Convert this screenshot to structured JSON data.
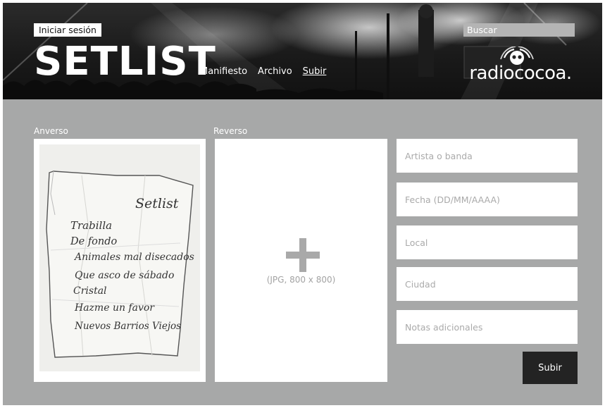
{
  "header": {
    "login_label": "Iniciar sesión",
    "logo_text": "SETLIST",
    "nav": [
      "Manifiesto",
      "Archivo",
      "Subir"
    ],
    "active_nav": "Subir",
    "search_placeholder": "Buscar",
    "partner_logo": "radiococoa."
  },
  "upload": {
    "front_label": "Anverso",
    "back_label": "Reverso",
    "back_hint": "(JPG, 800 x 800)",
    "setlist_note": {
      "title": "Setlist",
      "songs": [
        "Trabilla",
        "De fondo",
        "Animales mal disecados",
        "Que asco de sábado",
        "Cristal",
        "Hazme un favor",
        "Nuevos Barrios Viejos"
      ]
    }
  },
  "form": {
    "artist_placeholder": "Artista o banda",
    "date_placeholder": "Fecha (DD/MM/AAAA)",
    "venue_placeholder": "Local",
    "city_placeholder": "Ciudad",
    "notes_placeholder": "Notas adicionales",
    "submit_label": "Subir"
  },
  "colors": {
    "background": "#a7a8a8",
    "button": "#232323",
    "white": "#ffffff"
  }
}
